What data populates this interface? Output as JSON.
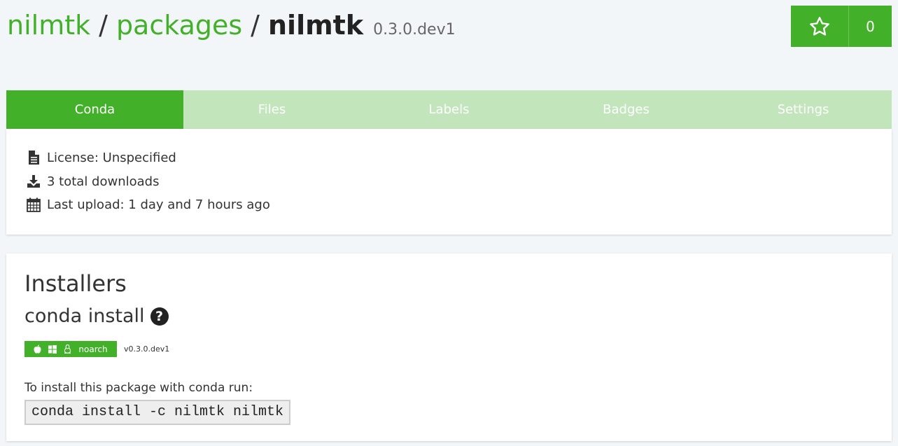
{
  "header": {
    "owner_link": "nilmtk",
    "packages_link": "packages",
    "separator": "/",
    "package_name": "nilmtk",
    "version": "0.3.0.dev1"
  },
  "star": {
    "count": "0",
    "icon": "star-outline-icon"
  },
  "tabs": [
    {
      "label": "Conda",
      "active": true
    },
    {
      "label": "Files",
      "active": false
    },
    {
      "label": "Labels",
      "active": false
    },
    {
      "label": "Badges",
      "active": false
    },
    {
      "label": "Settings",
      "active": false
    }
  ],
  "info": {
    "license": "License: Unspecified",
    "downloads": "3 total downloads",
    "last_upload": "Last upload: 1 day and 7 hours ago"
  },
  "installers": {
    "title": "Installers",
    "subtitle": "conda install",
    "badge_label": "noarch",
    "badge_version": "v0.3.0.dev1",
    "instruction": "To install this package with conda run:",
    "command": "conda install -c nilmtk nilmtk"
  },
  "colors": {
    "accent": "#43b02a",
    "tab_inactive": "#c2e5bc",
    "background": "#f3f6f9"
  }
}
